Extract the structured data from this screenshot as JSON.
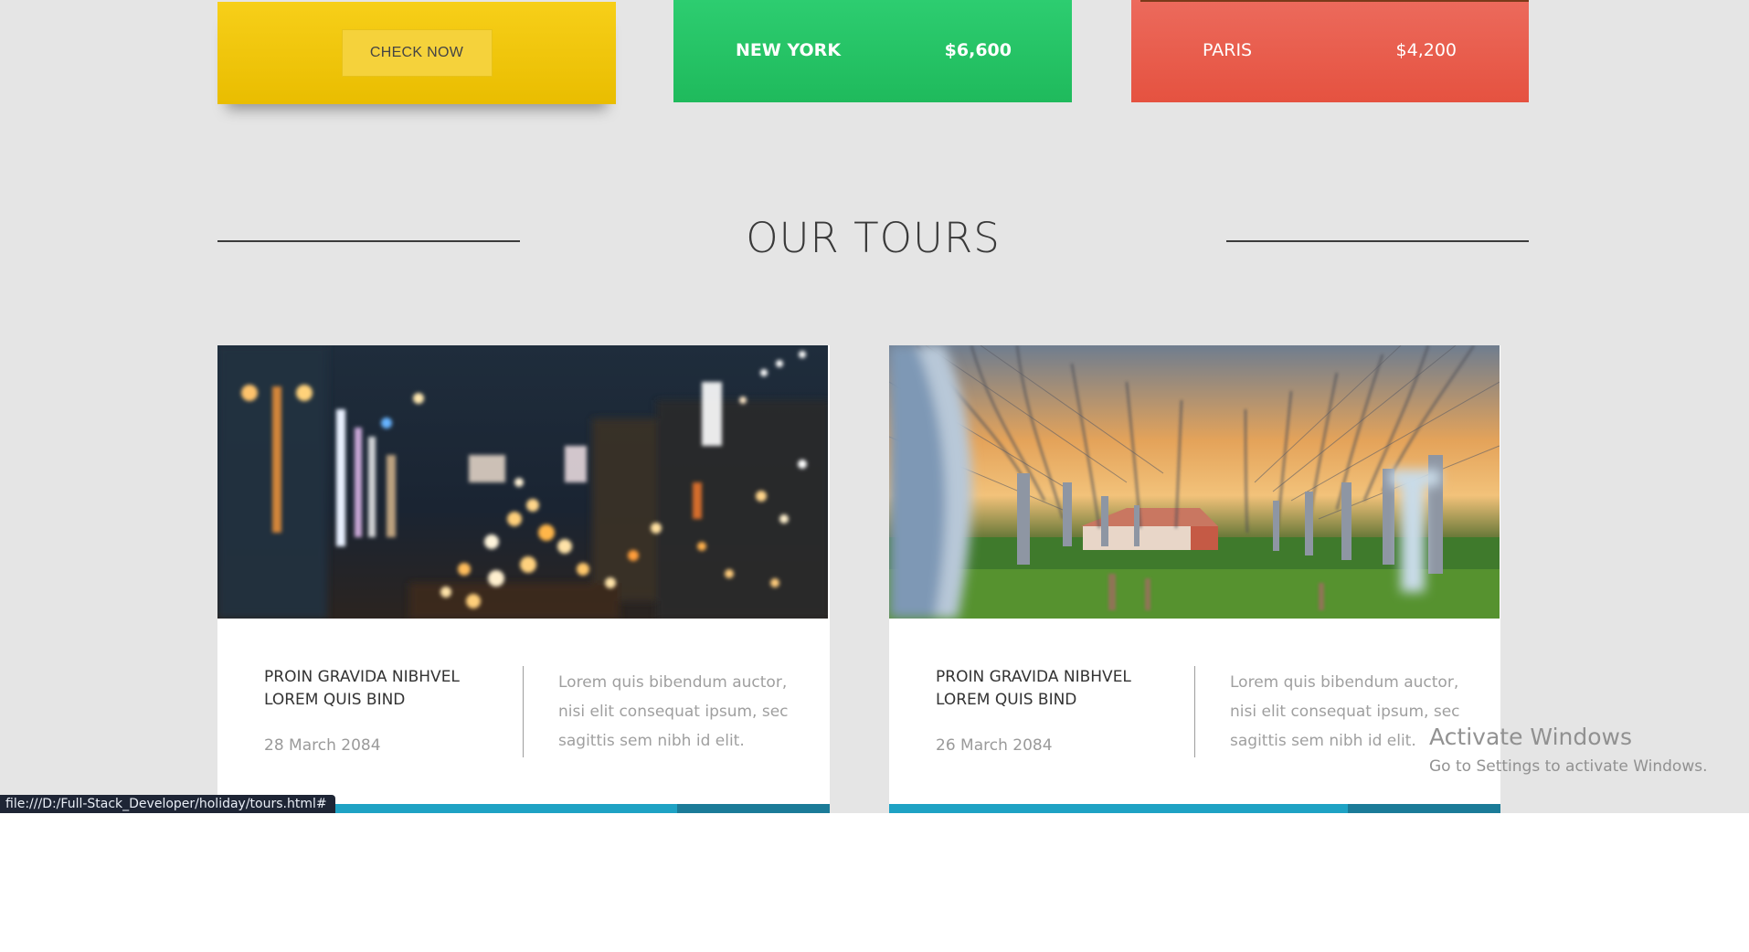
{
  "promo_cards": {
    "check_now_label": "CHECK NOW",
    "new_york": {
      "city": "NEW YORK",
      "price": "$6,600"
    },
    "paris": {
      "city": "PARIS",
      "price": "$4,200"
    }
  },
  "section": {
    "title": "OUR TOURS"
  },
  "tours": [
    {
      "title": "PROIN GRAVIDA NIBHVEL LOREM QUIS BIND",
      "date": "28 March 2084",
      "description": "Lorem quis bibendum auctor, nisi elit consequat ipsum, sec sagittis sem nibh id elit.",
      "image": "night-city-bokeh"
    },
    {
      "title": "PROIN GRAVIDA NIBHVEL LOREM QUIS BIND",
      "date": "26 March 2084",
      "description": "Lorem quis bibendum auctor, nisi elit consequat ipsum, sec sagittis sem nibh id elit.",
      "image": "orchard-trees-sunset"
    }
  ],
  "watermark": {
    "title": "Activate Windows",
    "subtitle": "Go to Settings to activate Windows."
  },
  "status_bar": {
    "url": "file:///D:/Full-Stack_Developer/holiday/tours.html#"
  },
  "colors": {
    "yellow": "#f2c811",
    "green": "#27c466",
    "red": "#e85d4c",
    "accent_bar": "#1ea2c4",
    "accent_bar_dark": "#1b7b98",
    "page_bg": "#e5e5e5"
  }
}
